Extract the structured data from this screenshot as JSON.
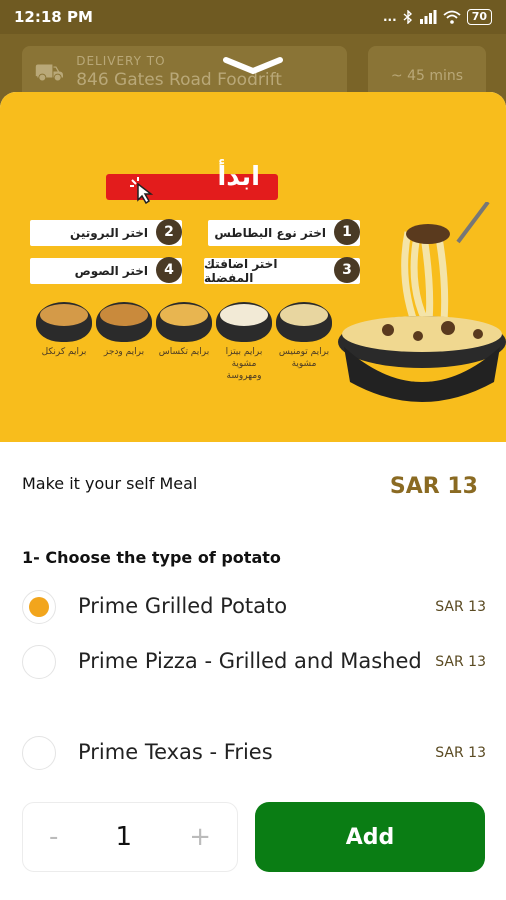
{
  "status_bar": {
    "time": "12:18 PM",
    "signal": "...",
    "battery": "70"
  },
  "header": {
    "delivery_label": "DELIVERY TO",
    "delivery_address": "846 Gates Road Foodrift",
    "eta": "~ 45 mins"
  },
  "banner": {
    "start": "ابدأ",
    "steps": [
      {
        "num": "1",
        "text": "اختر نوع البطاطس"
      },
      {
        "num": "2",
        "text": "اختر البروتين"
      },
      {
        "num": "3",
        "text": "اختر اضافتك المفضلة"
      },
      {
        "num": "4",
        "text": "اختر الصوص"
      }
    ],
    "potatoes": [
      {
        "label": "برايم تومنيس مشوية",
        "color": "#e8d6a0"
      },
      {
        "label": "برايم بيتزا مشوية ومهروسة",
        "color": "#f2ead6"
      },
      {
        "label": "برايم تكساس",
        "color": "#e8b550"
      },
      {
        "label": "برايم ودجز",
        "color": "#c98a3c"
      },
      {
        "label": "برايم كرنكل",
        "color": "#d49a48"
      }
    ]
  },
  "meal": {
    "title": "Make it your self Meal",
    "price": "SAR 13"
  },
  "section": {
    "title": "1- Choose the type of potato"
  },
  "options": [
    {
      "label": "Prime Grilled Potato",
      "price": "SAR 13",
      "selected": true
    },
    {
      "label": "Prime Pizza - Grilled and Mashed",
      "price": "SAR 13",
      "selected": false
    },
    {
      "label": "Prime Texas - Fries",
      "price": "SAR 13",
      "selected": false
    }
  ],
  "footer": {
    "minus": "-",
    "quantity": "1",
    "plus": "+",
    "add_label": "Add"
  },
  "colors": {
    "accent": "#f2a51c",
    "add_button": "#0a7d14",
    "price": "#8a6a22",
    "banner": "#f8bd1c"
  }
}
